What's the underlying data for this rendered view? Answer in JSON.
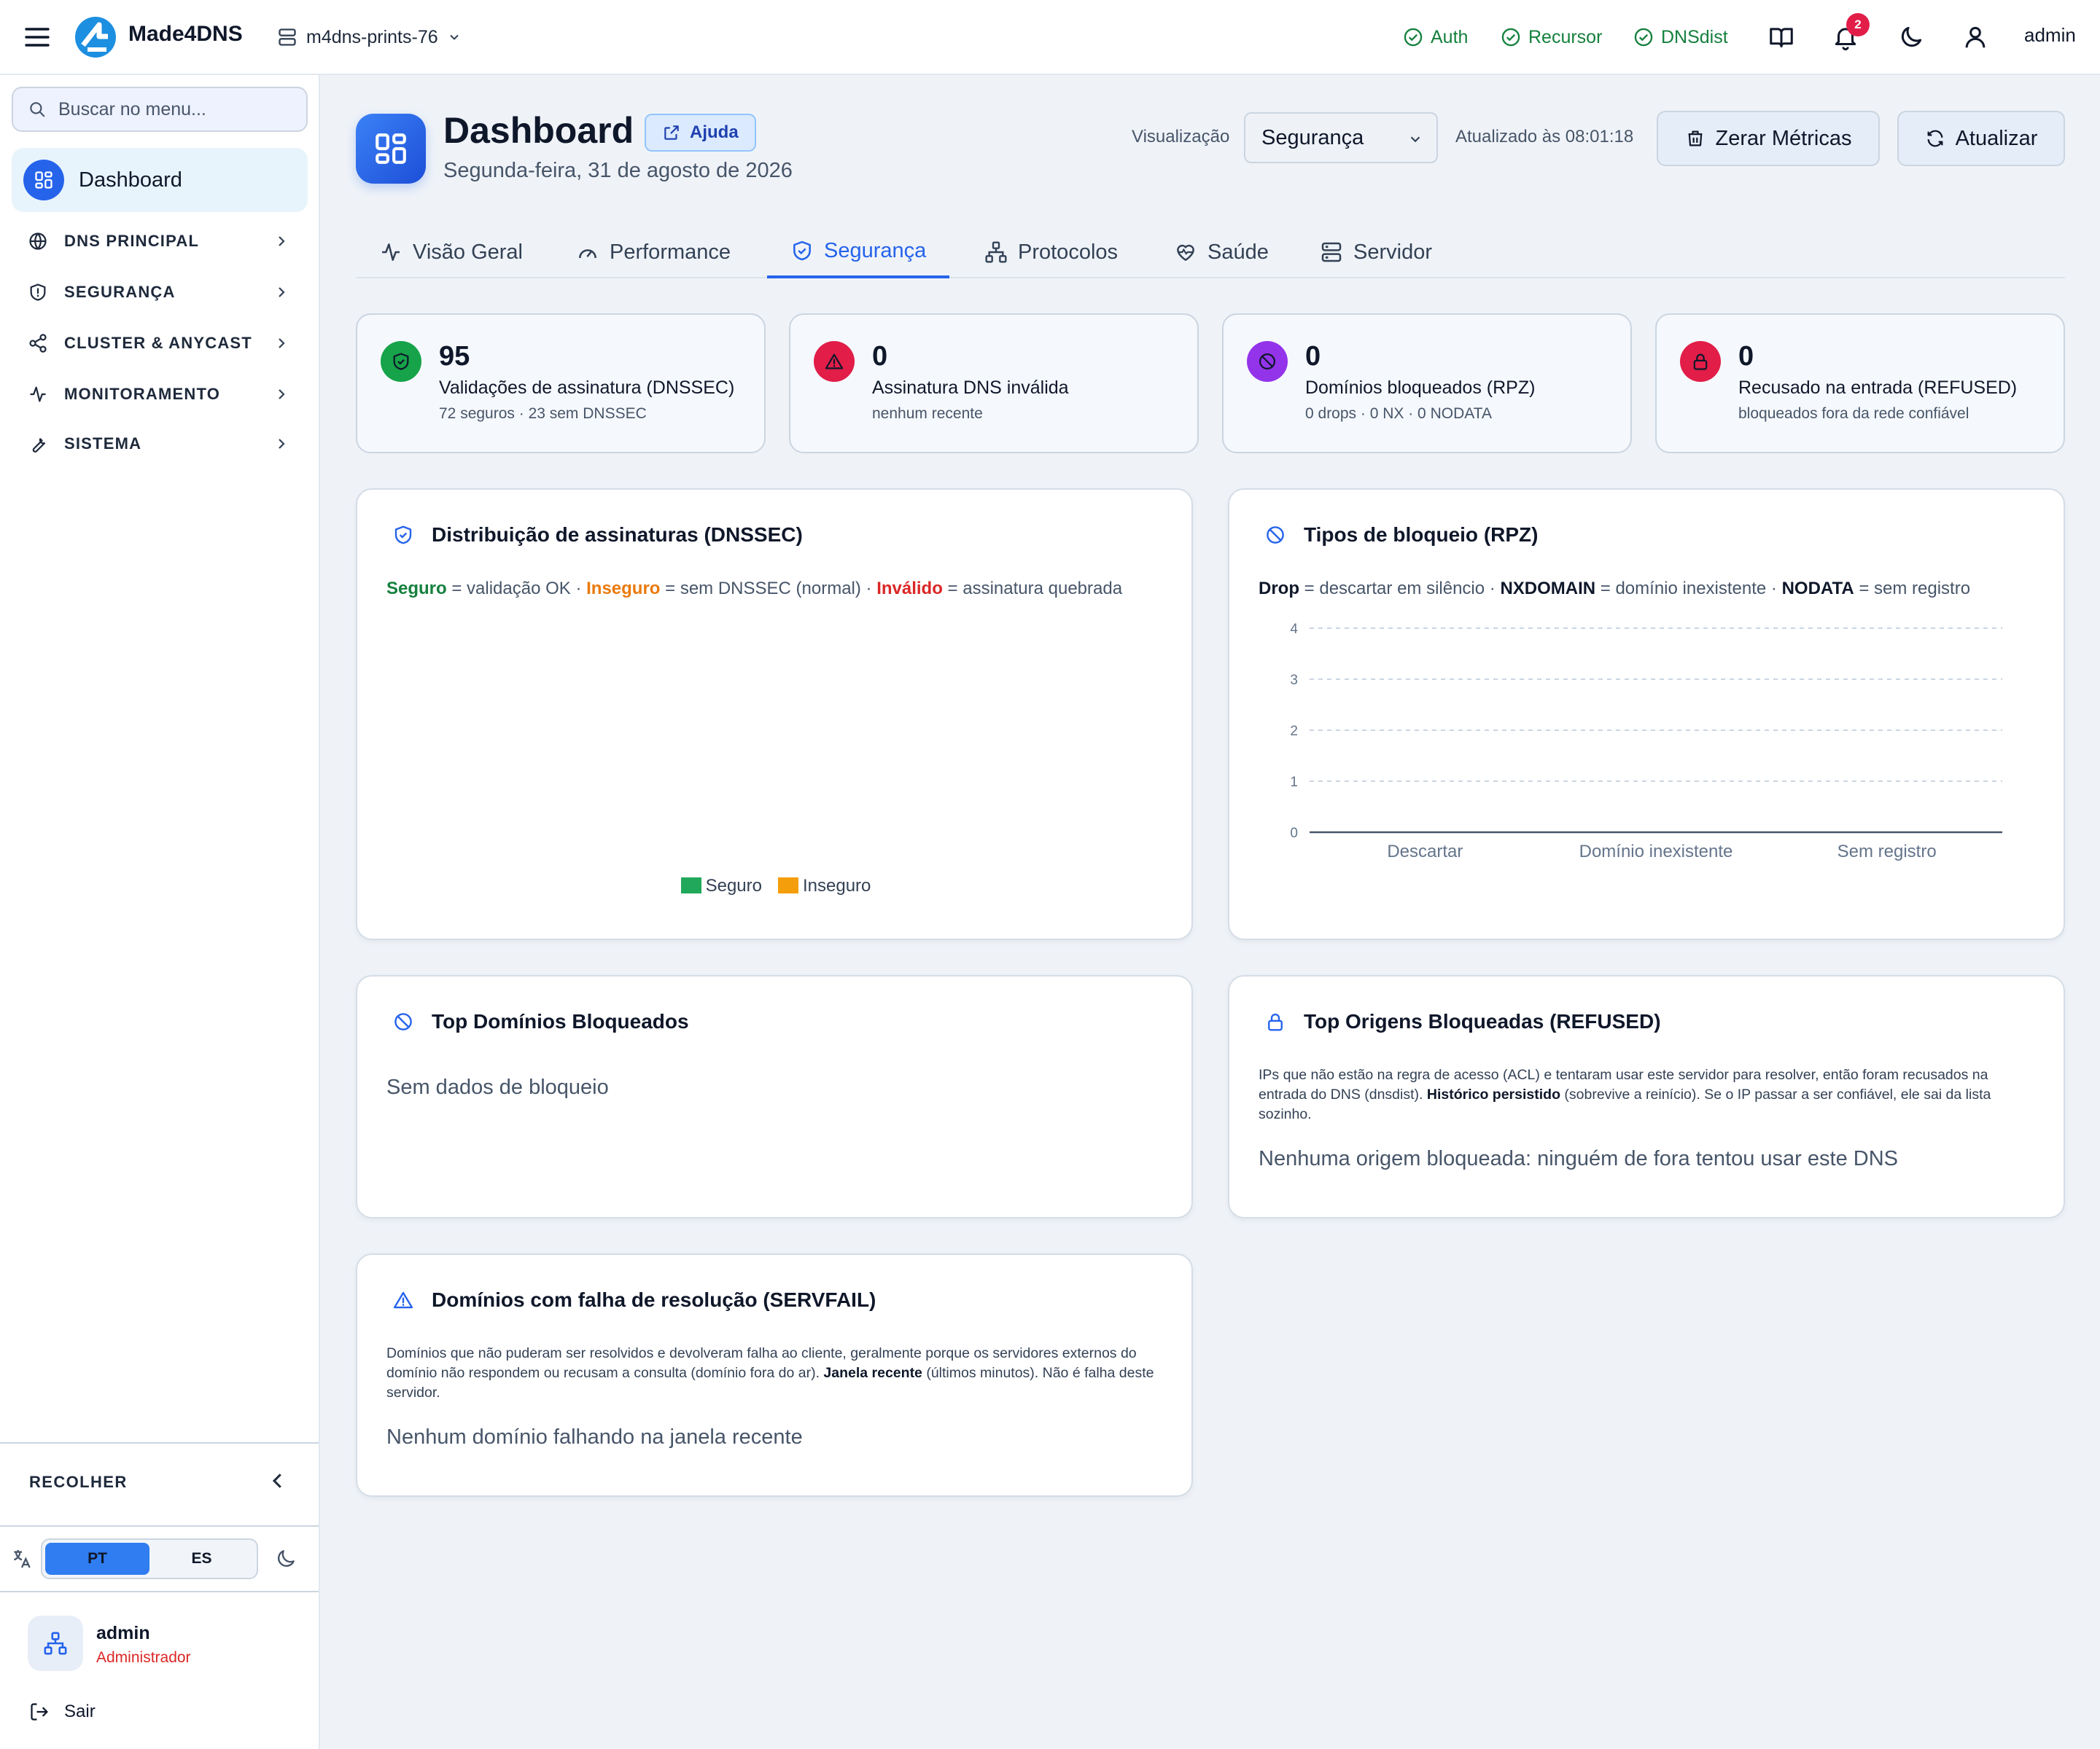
{
  "topbar": {
    "brand": "Made4DNS",
    "server": "m4dns-prints-76",
    "services": [
      "Auth",
      "Recursor",
      "DNSdist"
    ],
    "notifications": "2",
    "user": "admin"
  },
  "sidebar": {
    "search_placeholder": "Buscar no menu...",
    "active": "Dashboard",
    "items": [
      "DNS PRINCIPAL",
      "SEGURANÇA",
      "CLUSTER & ANYCAST",
      "MONITORAMENTO",
      "SISTEMA"
    ],
    "collapse": "RECOLHER",
    "lang": [
      "PT",
      "ES"
    ],
    "user_name": "admin",
    "user_role": "Administrador",
    "logout": "Sair"
  },
  "header": {
    "title": "Dashboard",
    "help": "Ajuda",
    "date": "Segunda-feira, 31 de agosto de 2026",
    "view_label": "Visualização",
    "view_value": "Segurança",
    "updated": "Atualizado às 08:01:18",
    "reset": "Zerar Métricas",
    "refresh": "Atualizar"
  },
  "tabs": [
    "Visão Geral",
    "Performance",
    "Segurança",
    "Protocolos",
    "Saúde",
    "Servidor"
  ],
  "stats": [
    {
      "value": "95",
      "label": "Validações de assinatura (DNSSEC)",
      "sub": "72 seguros · 23 sem DNSSEC",
      "color": "#16a34a"
    },
    {
      "value": "0",
      "label": "Assinatura DNS inválida",
      "sub": "nenhum recente",
      "color": "#e11d48"
    },
    {
      "value": "0",
      "label": "Domínios bloqueados (RPZ)",
      "sub": "0 drops · 0 NX · 0 NODATA",
      "color": "#9333ea"
    },
    {
      "value": "0",
      "label": "Recusado na entrada (REFUSED)",
      "sub": "bloqueados fora da rede confiável",
      "color": "#e11d48"
    }
  ],
  "dnssec_panel": {
    "title": "Distribuição de assinaturas (DNSSEC)",
    "legend_parts": [
      "Seguro",
      " = validação OK · ",
      "Inseguro",
      " = sem DNSSEC (normal) · ",
      "Inválido",
      " = assinatura quebrada"
    ],
    "chart_legend": [
      "Seguro",
      "Inseguro"
    ],
    "colors": {
      "seguro": "#16a34a",
      "inseguro": "#f59e0b",
      "invalido": "#dc2626"
    }
  },
  "rpz_panel": {
    "title": "Tipos de bloqueio (RPZ)",
    "legend_parts": [
      "Drop",
      " = descartar em silêncio · ",
      "NXDOMAIN",
      " = domínio inexistente · ",
      "NODATA",
      " = sem registro"
    ]
  },
  "blocked_panel": {
    "title": "Top Domínios Bloqueados",
    "empty": "Sem dados de bloqueio"
  },
  "refused_panel": {
    "title": "Top Origens Bloqueadas (REFUSED)",
    "desc_1": "IPs que não estão na regra de acesso (ACL) e tentaram usar este servidor para resolver, então foram recusados na entrada do DNS (dnsdist). ",
    "desc_bold": "Histórico persistido",
    "desc_2": " (sobrevive a reinício). Se o IP passar a ser confiável, ele sai da lista sozinho.",
    "empty": "Nenhuma origem bloqueada: ninguém de fora tentou usar este DNS"
  },
  "servfail_panel": {
    "title": "Domínios com falha de resolução (SERVFAIL)",
    "desc_1": "Domínios que não puderam ser resolvidos e devolveram falha ao cliente, geralmente porque os servidores externos do domínio não respondem ou recusam a consulta (domínio fora do ar). ",
    "desc_bold": "Janela recente",
    "desc_2": " (últimos minutos). Não é falha deste servidor.",
    "empty": "Nenhum domínio falhando na janela recente"
  },
  "chart_data": [
    {
      "type": "pie",
      "title": "Distribuição de assinaturas (DNSSEC)",
      "categories": [
        "Seguro",
        "Inseguro"
      ],
      "values": [],
      "legend": "bottom"
    },
    {
      "type": "bar",
      "title": "Tipos de bloqueio (RPZ)",
      "categories": [
        "Descartar",
        "Domínio inexistente",
        "Sem registro"
      ],
      "values": [
        0,
        0,
        0
      ],
      "ylim": [
        0,
        4
      ],
      "yticks": [
        "0",
        "1",
        "2",
        "3",
        "4"
      ],
      "grid": true
    }
  ]
}
